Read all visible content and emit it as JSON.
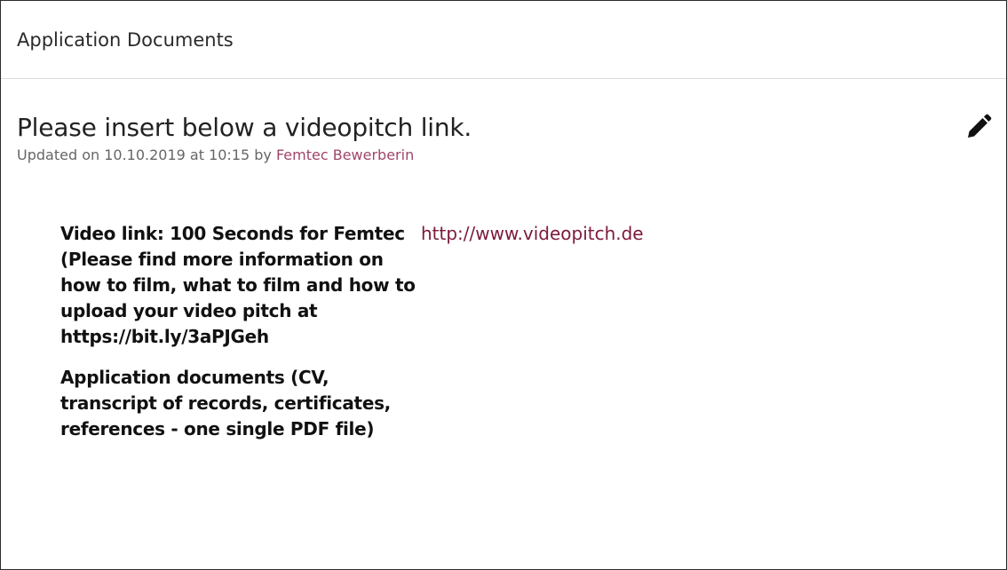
{
  "panel": {
    "title": "Application Documents"
  },
  "question": {
    "title": "Please insert below a videopitch link.",
    "meta_prefix": "Updated on 10.10.2019 at 10:15 by ",
    "author": "Femtec Bewerberin",
    "edit_icon": "pencil-icon"
  },
  "fields": [
    {
      "label": "Video link: 100 Seconds for Femtec (Please find more information on how to film, what to film and how to upload your video pitch at https://bit.ly/3aPJGeh",
      "value": "http://www.videopitch.de"
    },
    {
      "label": "Application documents (CV, transcript of records, certificates, references - one single PDF file)",
      "value": ""
    }
  ],
  "colors": {
    "link": "#7d1a3b",
    "author": "#a0476a",
    "border": "#2b2b2b"
  }
}
